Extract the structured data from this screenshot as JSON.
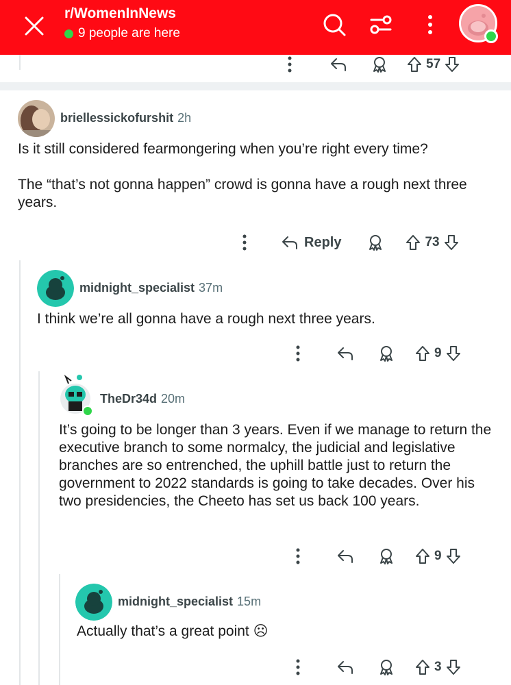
{
  "header": {
    "subreddit": "r/WomenInNews",
    "online_text": "9 people are here"
  },
  "top_comment_actions": {
    "votes": "57"
  },
  "comments": [
    {
      "username": "briellessickofurshit",
      "age": "2h",
      "body": [
        "Is it still considered fearmongering when you’re right every time?",
        "The “that’s not gonna happen” crowd is gonna have a rough next three years."
      ],
      "reply_label": "Reply",
      "votes": "73"
    },
    {
      "username": "midnight_specialist",
      "age": "37m",
      "body": [
        "I think we’re all gonna have a rough next three years."
      ],
      "votes": "9"
    },
    {
      "username": "TheDr34d",
      "age": "20m",
      "body": [
        "It’s going to be longer than 3 years. Even if we manage to return the executive branch to some normalcy, the judicial and legislative branches are so entrenched, the uphill battle just to return the government to 2022 standards is going to take decades. Over his two presidencies, the Cheeto has set us back 100 years."
      ],
      "votes": "9"
    },
    {
      "username": "midnight_specialist",
      "age": "15m",
      "body": [
        "Actually that’s a great point ☹"
      ],
      "votes": "3"
    }
  ],
  "colors": {
    "header_bg": "#ff0a14",
    "online_dot": "#2fd64a",
    "avatar_teal": "#24c7ad"
  },
  "icons": [
    "close-icon",
    "search-icon",
    "filter-icon",
    "more-icon",
    "user-avatar",
    "overflow-icon",
    "reply-icon",
    "award-icon",
    "upvote-icon",
    "downvote-icon"
  ]
}
